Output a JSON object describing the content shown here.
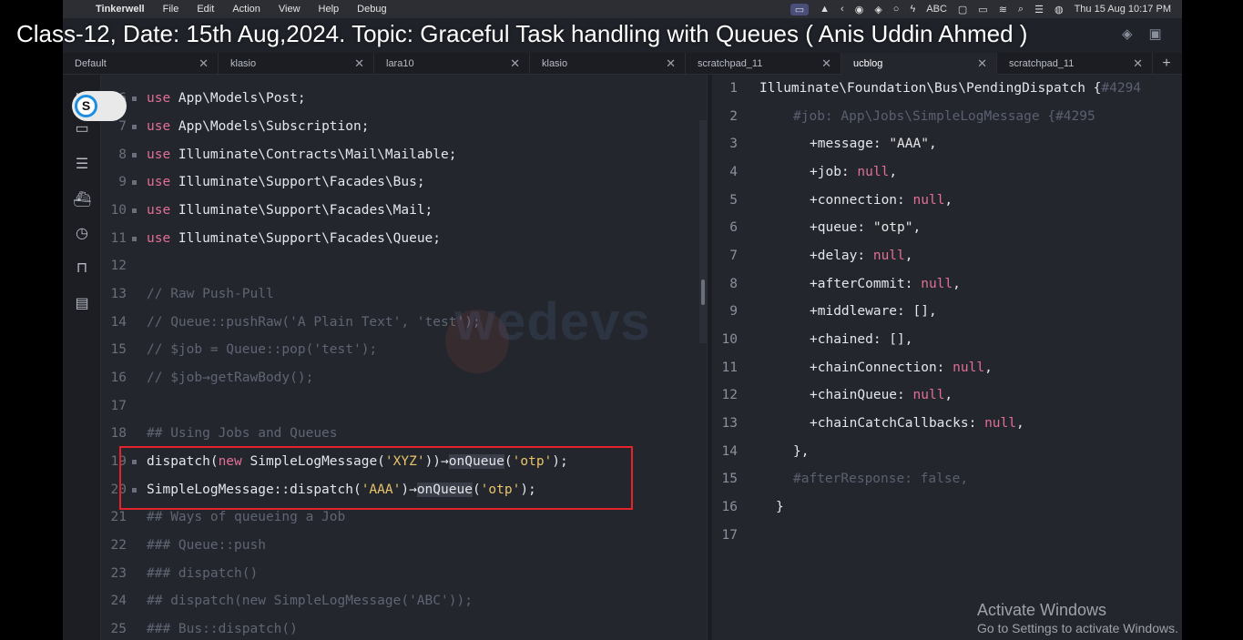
{
  "video_title": "Class-12, Date: 15th Aug,2024. Topic: Graceful Task handling with Queues ( Anis Uddin Ahmed )",
  "menubar": {
    "app_name": "Tinkerwell",
    "items": [
      "File",
      "Edit",
      "Action",
      "View",
      "Help",
      "Debug"
    ],
    "input_source": "ABC",
    "datetime": "Thu 15 Aug  10:17 PM"
  },
  "tabs": [
    {
      "label": "Default",
      "active": false
    },
    {
      "label": "klasio",
      "active": false
    },
    {
      "label": "lara10",
      "active": false
    },
    {
      "label": "klasio",
      "active": false
    },
    {
      "label": "scratchpad_11",
      "active": false
    },
    {
      "label": "ucblog",
      "active": true
    },
    {
      "label": "scratchpad_11",
      "active": false
    }
  ],
  "toggle": {
    "letter": "S"
  },
  "editor": {
    "lines": [
      {
        "n": "6",
        "text": "use App\\Models\\Post;"
      },
      {
        "n": "7",
        "text": "use App\\Models\\Subscription;"
      },
      {
        "n": "8",
        "text": "use Illuminate\\Contracts\\Mail\\Mailable;"
      },
      {
        "n": "9",
        "text": "use Illuminate\\Support\\Facades\\Bus;"
      },
      {
        "n": "10",
        "text": "use Illuminate\\Support\\Facades\\Mail;"
      },
      {
        "n": "11",
        "text": "use Illuminate\\Support\\Facades\\Queue;"
      },
      {
        "n": "12",
        "text": ""
      },
      {
        "n": "13",
        "text": "// Raw Push-Pull"
      },
      {
        "n": "14",
        "text": "// Queue::pushRaw('A Plain Text', 'test');"
      },
      {
        "n": "15",
        "text": "// $job = Queue::pop('test');"
      },
      {
        "n": "16",
        "text": "// $job→getRawBody();"
      },
      {
        "n": "17",
        "text": ""
      },
      {
        "n": "18",
        "text": "## Using Jobs and Queues"
      },
      {
        "n": "19",
        "text": "dispatch(new SimpleLogMessage('XYZ'))→onQueue('otp');"
      },
      {
        "n": "20",
        "text": "SimpleLogMessage::dispatch('AAA')→onQueue('otp');"
      },
      {
        "n": "21",
        "text": "## Ways of queueing a Job"
      },
      {
        "n": "22",
        "text": "### Queue::push"
      },
      {
        "n": "23",
        "text": "### dispatch()"
      },
      {
        "n": "24",
        "text": "## dispatch(new SimpleLogMessage('ABC'));"
      },
      {
        "n": "25",
        "text": "### Bus::dispatch()"
      }
    ]
  },
  "output": {
    "lines": [
      {
        "n": "1",
        "text": "Illuminate\\Foundation\\Bus\\PendingDispatch {#4294"
      },
      {
        "n": "2",
        "text": "#job: App\\Jobs\\SimpleLogMessage {#4295"
      },
      {
        "n": "3",
        "text": "+message: \"AAA\","
      },
      {
        "n": "4",
        "text": "+job: null,"
      },
      {
        "n": "5",
        "text": "+connection: null,"
      },
      {
        "n": "6",
        "text": "+queue: \"otp\","
      },
      {
        "n": "7",
        "text": "+delay: null,"
      },
      {
        "n": "8",
        "text": "+afterCommit: null,"
      },
      {
        "n": "9",
        "text": "+middleware: [],"
      },
      {
        "n": "10",
        "text": "+chained: [],"
      },
      {
        "n": "11",
        "text": "+chainConnection: null,"
      },
      {
        "n": "12",
        "text": "+chainQueue: null,"
      },
      {
        "n": "13",
        "text": "+chainCatchCallbacks: null,"
      },
      {
        "n": "14",
        "text": "},"
      },
      {
        "n": "15",
        "text": "#afterResponse: false,"
      },
      {
        "n": "16",
        "text": "}"
      },
      {
        "n": "17",
        "text": ""
      }
    ]
  },
  "watermark": {
    "text": "wedevs"
  },
  "activation": {
    "title": "Activate Windows",
    "subtitle": "Go to Settings to activate Windows."
  },
  "colors": {
    "keyword": "#e36f96",
    "comment": "#5f6573",
    "string": "#e9c46a",
    "highlight_box": "#e5232b",
    "background": "#23262d"
  }
}
